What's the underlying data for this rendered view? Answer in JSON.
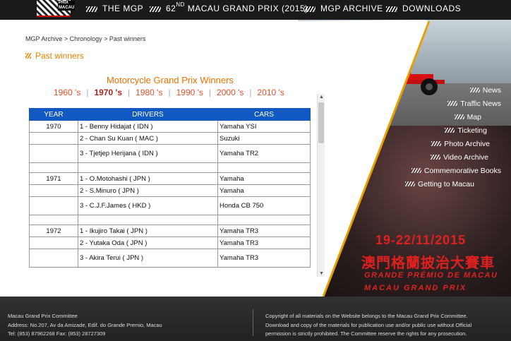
{
  "nav": {
    "logo_text": "PRIX MACAU",
    "items": [
      {
        "label": "THE MGP"
      },
      {
        "prefix": "62",
        "sup": "ND",
        "label": " MACAU GRAND PRIX (2015)"
      },
      {
        "label": "MGP ARCHIVE"
      },
      {
        "label": "DOWNLOADS"
      }
    ]
  },
  "breadcrumb": "MGP Archive > Chronology > Past winners",
  "page_heading": "Past winners",
  "section_title": "Motorcycle Grand Prix Winners",
  "decades": [
    "1960 's",
    "1970 's",
    "1980 's",
    "1990 's",
    "2000 's",
    "2010 's"
  ],
  "active_decade": "1970 's",
  "table": {
    "headers": [
      "YEAR",
      "DRIVERS",
      "CARS"
    ],
    "rows": [
      {
        "year": "1970",
        "driver": "1 - Benny Hidajat ( IDN )",
        "car": "Yamaha YSI"
      },
      {
        "year": "",
        "driver": "2 - Chan Su Kuan ( MAC )",
        "car": "Suzuki"
      },
      {
        "year": "",
        "driver": "3 - Tjetjep Herijana ( IDN )",
        "car": "Yamaha TR2"
      },
      {
        "year": "",
        "driver": "",
        "car": ""
      },
      {
        "year": "1971",
        "driver": "1 - O.Motohashi ( JPN )",
        "car": "Yamaha"
      },
      {
        "year": "",
        "driver": "2 - S.Minuro ( JPN )",
        "car": "Yamaha"
      },
      {
        "year": "",
        "driver": "3 - C.J.F.James ( HKD )",
        "car": "Honda CB 750"
      },
      {
        "year": "",
        "driver": "",
        "car": ""
      },
      {
        "year": "1972",
        "driver": "1 - Ikujiro Takai ( JPN )",
        "car": "Yamaha TR3"
      },
      {
        "year": "",
        "driver": "2 - Yutaka Oda ( JPN )",
        "car": "Yamaha TR3"
      },
      {
        "year": "",
        "driver": "3 - Akira Terui ( JPN )",
        "car": "Yamaha TR3"
      }
    ]
  },
  "side_menu": [
    "News",
    "Traffic News",
    "Map",
    "Ticketing",
    "Photo Archive",
    "Video Archive",
    "Commemorative Books",
    "Getting to Macau"
  ],
  "hero": {
    "dates": "19-22/11/2015",
    "title_cn": "澳門格蘭披治大賽車",
    "title_pt": "GRANDE PRÉMIO DE MACAU",
    "title_en": "MACAU GRAND PRIX"
  },
  "footer": {
    "left": [
      "Macau Grand Prix Committee",
      "Address: No.207, Av da Amizade, Edif. do Grande Premio, Macau",
      "Tel: (853) 87962268 Fax: (853) 28727309"
    ],
    "right": [
      "Copyright of all materials on the Website belongs to the Macau Grand Prix Committee.",
      "Download and copy of the materials for publication use and/or public use without Official",
      "permission is strictly prohibited. The Committee reserve the rights for any prosecution."
    ]
  },
  "colors": {
    "accent": "#f07000",
    "header_blue": "#1259c3",
    "race_red": "#e02020"
  }
}
